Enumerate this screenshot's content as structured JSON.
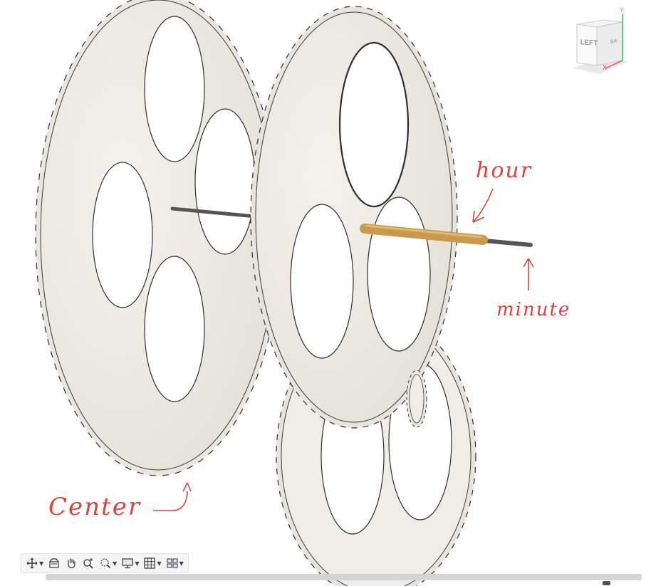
{
  "viewcube": {
    "face_label": "LEFT",
    "edge_label": "BA",
    "axis_x": "X",
    "axis_y": "Y"
  },
  "annotations": {
    "hour": "hour",
    "minute": "minute",
    "center": "Center"
  },
  "toolbar": {
    "items": [
      {
        "name": "orbit",
        "icon": "orbit-icon",
        "has_dropdown": true
      },
      {
        "name": "look-at",
        "icon": "look-at-icon",
        "has_dropdown": false
      },
      {
        "name": "pan",
        "icon": "hand-icon",
        "has_dropdown": false
      },
      {
        "name": "zoom",
        "icon": "zoom-icon",
        "has_dropdown": false
      },
      {
        "name": "fit",
        "icon": "fit-icon",
        "has_dropdown": true
      },
      {
        "name": "display-settings",
        "icon": "display-icon",
        "has_dropdown": true
      },
      {
        "name": "grid-snaps",
        "icon": "grid-icon",
        "has_dropdown": true
      },
      {
        "name": "viewports",
        "icon": "viewports-icon",
        "has_dropdown": true
      }
    ]
  },
  "colors": {
    "gear_fill": "#efede6",
    "gear_stroke": "#2f2f2f",
    "shaft": "#555555",
    "brass": "#c99a4c",
    "annotation": "#d9453b"
  }
}
